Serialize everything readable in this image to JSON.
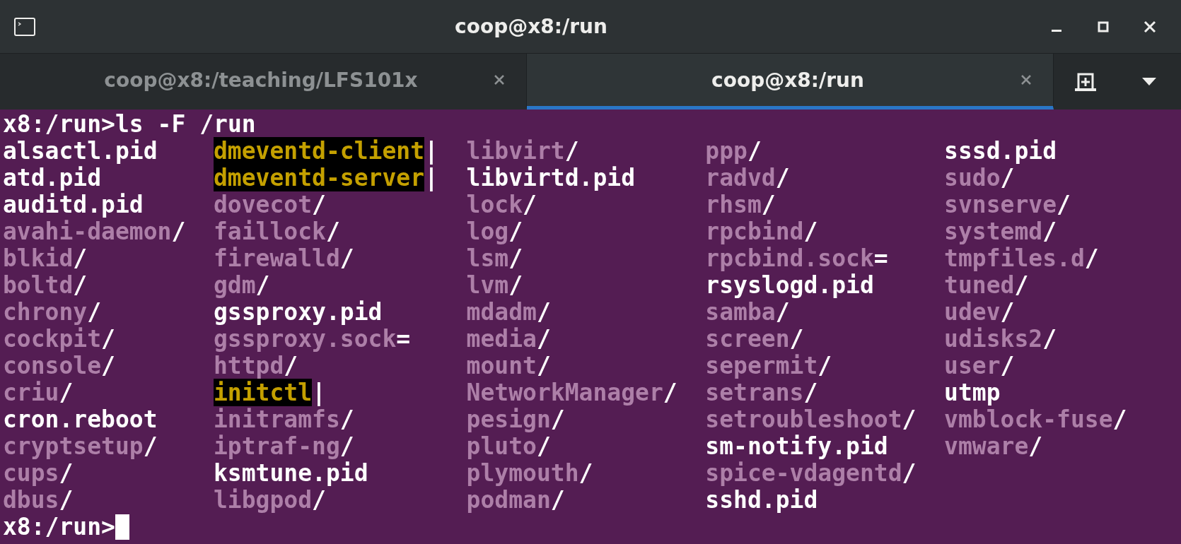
{
  "window": {
    "title": "coop@x8:/run"
  },
  "tabs": [
    {
      "label": "coop@x8:/teaching/LFS101x",
      "selected": false
    },
    {
      "label": "coop@x8:/run",
      "selected": true
    }
  ],
  "terminal": {
    "command_line": "x8:/run>ls -F /run",
    "prompt": "x8:/run>",
    "cursor_visible": true,
    "columns": [
      [
        {
          "kind": "file",
          "name": "alsactl.pid"
        },
        {
          "kind": "file",
          "name": "atd.pid"
        },
        {
          "kind": "file",
          "name": "auditd.pid"
        },
        {
          "kind": "dir",
          "name": "avahi-daemon",
          "suffix": "/"
        },
        {
          "kind": "dir",
          "name": "blkid",
          "suffix": "/"
        },
        {
          "kind": "dir",
          "name": "boltd",
          "suffix": "/"
        },
        {
          "kind": "dir",
          "name": "chrony",
          "suffix": "/"
        },
        {
          "kind": "dir",
          "name": "cockpit",
          "suffix": "/"
        },
        {
          "kind": "dir",
          "name": "console",
          "suffix": "/"
        },
        {
          "kind": "dir",
          "name": "criu",
          "suffix": "/"
        },
        {
          "kind": "file",
          "name": "cron.reboot"
        },
        {
          "kind": "dir",
          "name": "cryptsetup",
          "suffix": "/"
        },
        {
          "kind": "dir",
          "name": "cups",
          "suffix": "/"
        },
        {
          "kind": "dir",
          "name": "dbus",
          "suffix": "/"
        }
      ],
      [
        {
          "kind": "pipe",
          "name": "dmeventd-client",
          "suffix": "|"
        },
        {
          "kind": "pipe",
          "name": "dmeventd-server",
          "suffix": "|"
        },
        {
          "kind": "dir",
          "name": "dovecot",
          "suffix": "/"
        },
        {
          "kind": "dir",
          "name": "faillock",
          "suffix": "/"
        },
        {
          "kind": "dir",
          "name": "firewalld",
          "suffix": "/"
        },
        {
          "kind": "dir",
          "name": "gdm",
          "suffix": "/"
        },
        {
          "kind": "file",
          "name": "gssproxy.pid"
        },
        {
          "kind": "socket",
          "name": "gssproxy.sock",
          "suffix": "="
        },
        {
          "kind": "dir",
          "name": "httpd",
          "suffix": "/"
        },
        {
          "kind": "pipe",
          "name": "initctl",
          "suffix": "|"
        },
        {
          "kind": "dir",
          "name": "initramfs",
          "suffix": "/"
        },
        {
          "kind": "dir",
          "name": "iptraf-ng",
          "suffix": "/"
        },
        {
          "kind": "file",
          "name": "ksmtune.pid"
        },
        {
          "kind": "dir",
          "name": "libgpod",
          "suffix": "/"
        }
      ],
      [
        {
          "kind": "dir",
          "name": "libvirt",
          "suffix": "/"
        },
        {
          "kind": "file",
          "name": "libvirtd.pid"
        },
        {
          "kind": "dir",
          "name": "lock",
          "suffix": "/"
        },
        {
          "kind": "dir",
          "name": "log",
          "suffix": "/"
        },
        {
          "kind": "dir",
          "name": "lsm",
          "suffix": "/"
        },
        {
          "kind": "dir",
          "name": "lvm",
          "suffix": "/"
        },
        {
          "kind": "dir",
          "name": "mdadm",
          "suffix": "/"
        },
        {
          "kind": "dir",
          "name": "media",
          "suffix": "/"
        },
        {
          "kind": "dir",
          "name": "mount",
          "suffix": "/"
        },
        {
          "kind": "dir",
          "name": "NetworkManager",
          "suffix": "/"
        },
        {
          "kind": "dir",
          "name": "pesign",
          "suffix": "/"
        },
        {
          "kind": "dir",
          "name": "pluto",
          "suffix": "/"
        },
        {
          "kind": "dir",
          "name": "plymouth",
          "suffix": "/"
        },
        {
          "kind": "dir",
          "name": "podman",
          "suffix": "/"
        }
      ],
      [
        {
          "kind": "dir",
          "name": "ppp",
          "suffix": "/"
        },
        {
          "kind": "dir",
          "name": "radvd",
          "suffix": "/"
        },
        {
          "kind": "dir",
          "name": "rhsm",
          "suffix": "/"
        },
        {
          "kind": "dir",
          "name": "rpcbind",
          "suffix": "/"
        },
        {
          "kind": "socket",
          "name": "rpcbind.sock",
          "suffix": "="
        },
        {
          "kind": "file",
          "name": "rsyslogd.pid"
        },
        {
          "kind": "dir",
          "name": "samba",
          "suffix": "/"
        },
        {
          "kind": "dir",
          "name": "screen",
          "suffix": "/"
        },
        {
          "kind": "dir",
          "name": "sepermit",
          "suffix": "/"
        },
        {
          "kind": "dir",
          "name": "setrans",
          "suffix": "/"
        },
        {
          "kind": "dir",
          "name": "setroubleshoot",
          "suffix": "/"
        },
        {
          "kind": "file",
          "name": "sm-notify.pid"
        },
        {
          "kind": "dir",
          "name": "spice-vdagentd",
          "suffix": "/"
        },
        {
          "kind": "file",
          "name": "sshd.pid"
        }
      ],
      [
        {
          "kind": "file",
          "name": "sssd.pid"
        },
        {
          "kind": "dir",
          "name": "sudo",
          "suffix": "/"
        },
        {
          "kind": "dir",
          "name": "svnserve",
          "suffix": "/"
        },
        {
          "kind": "dir",
          "name": "systemd",
          "suffix": "/"
        },
        {
          "kind": "dir",
          "name": "tmpfiles.d",
          "suffix": "/"
        },
        {
          "kind": "dir",
          "name": "tuned",
          "suffix": "/"
        },
        {
          "kind": "dir",
          "name": "udev",
          "suffix": "/"
        },
        {
          "kind": "dir",
          "name": "udisks2",
          "suffix": "/"
        },
        {
          "kind": "dir",
          "name": "user",
          "suffix": "/"
        },
        {
          "kind": "file",
          "name": "utmp"
        },
        {
          "kind": "dir",
          "name": "vmblock-fuse",
          "suffix": "/"
        },
        {
          "kind": "dir",
          "name": "vmware",
          "suffix": "/"
        }
      ]
    ]
  }
}
